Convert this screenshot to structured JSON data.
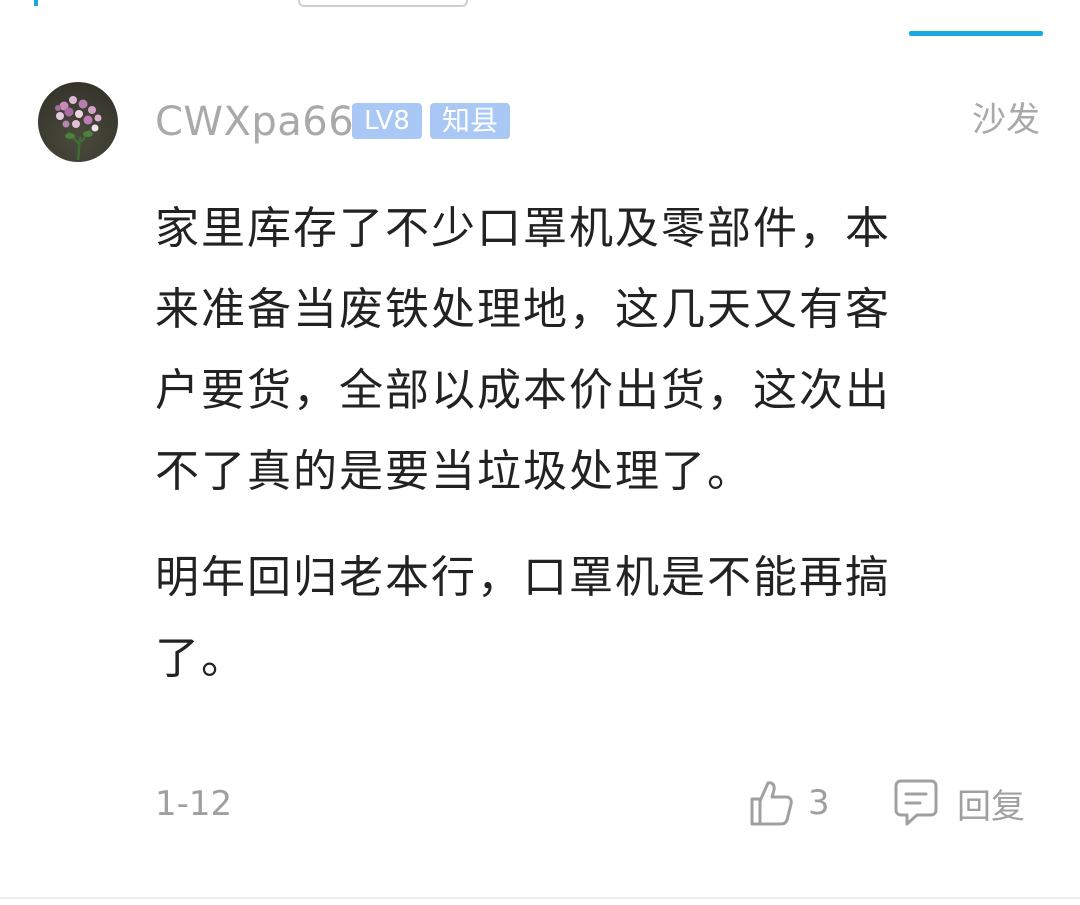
{
  "comment": {
    "username": "CWXpa66",
    "level_badge": "LV8",
    "rank_badge": "知县",
    "floor": "沙发",
    "paragraphs": [
      "家里库存了不少口罩机及零部件，本\n来准备当废铁处理地，这几天又有客\n户要货，全部以成本价出货，这次出\n不了真的是要当垃圾处理了。",
      "明年回归老本行，口罩机是不能再搞\n了。"
    ],
    "date": "1-12",
    "like_count": "3",
    "reply_label": "回复"
  },
  "icons": {
    "avatar": "flower-bouquet-avatar",
    "like": "thumbs-up-icon",
    "reply": "comment-bubble-icon"
  },
  "colors": {
    "accent": "#19a9e1",
    "badge": "#a9c8f5",
    "muted_text": "#a9a9a9",
    "body_text": "#222222"
  }
}
